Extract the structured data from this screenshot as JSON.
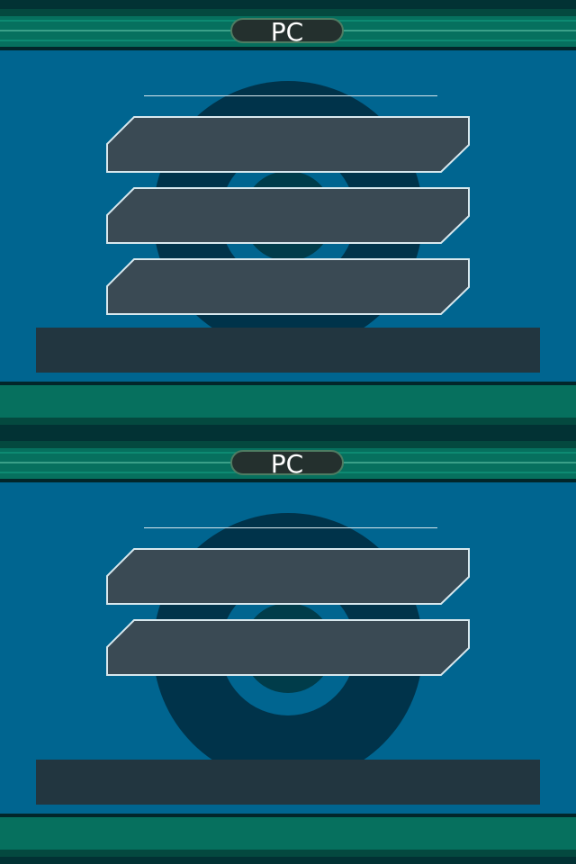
{
  "screens": [
    {
      "title": "PC",
      "options": [
        "",
        "",
        ""
      ],
      "message": ""
    },
    {
      "title": "PC",
      "options": [
        "",
        ""
      ],
      "message": ""
    }
  ],
  "colors": {
    "background": "#006590",
    "header_green": "#06705e",
    "option_fill": "#3a4a54",
    "option_border": "#d8e8ee",
    "message_box": "#223640"
  }
}
